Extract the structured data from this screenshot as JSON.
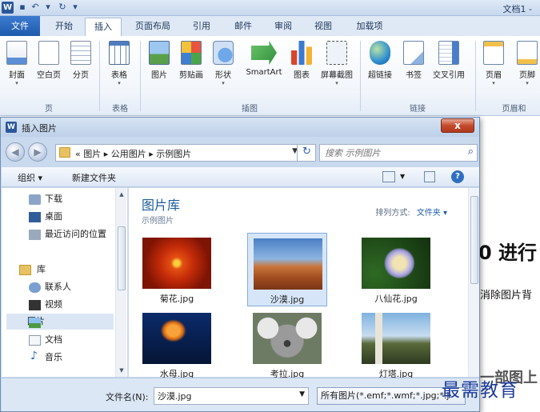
{
  "titlebar": {
    "app_icon": "W",
    "doc_title": "文档1 -"
  },
  "tabs": [
    {
      "label": "文件"
    },
    {
      "label": "开始"
    },
    {
      "label": "插入"
    },
    {
      "label": "页面布局"
    },
    {
      "label": "引用"
    },
    {
      "label": "邮件"
    },
    {
      "label": "审阅"
    },
    {
      "label": "视图"
    },
    {
      "label": "加载项"
    }
  ],
  "ribbon": {
    "buttons": [
      {
        "label": "封面",
        "icon": "cover-page-icon"
      },
      {
        "label": "空白页",
        "icon": "blank-page-icon"
      },
      {
        "label": "分页",
        "icon": "page-break-icon"
      },
      {
        "label": "表格",
        "icon": "table-icon"
      },
      {
        "label": "图片",
        "icon": "picture-icon"
      },
      {
        "label": "剪贴画",
        "icon": "clip-art-icon"
      },
      {
        "label": "形状",
        "icon": "shapes-icon"
      },
      {
        "label": "SmartArt",
        "icon": "smartart-icon"
      },
      {
        "label": "图表",
        "icon": "chart-icon"
      },
      {
        "label": "屏幕截图",
        "icon": "screenshot-icon"
      },
      {
        "label": "超链接",
        "icon": "hyperlink-icon"
      },
      {
        "label": "书签",
        "icon": "bookmark-icon"
      },
      {
        "label": "交叉引用",
        "icon": "cross-reference-icon"
      },
      {
        "label": "页眉",
        "icon": "header-icon"
      },
      {
        "label": "页脚",
        "icon": "footer-icon"
      }
    ],
    "groups": [
      "页",
      "表格",
      "插图",
      "链接",
      "页眉和"
    ]
  },
  "document": {
    "heading_fragment": "0 进行",
    "line_fragment": "消除图片背",
    "bottom_fragment": "一部图上"
  },
  "dialog": {
    "title": "插入图片",
    "close_label": "x",
    "address": {
      "prefix": "«",
      "crumbs": "图片  ▸  公用图片  ▸  示例图片"
    },
    "search": {
      "placeholder": "搜索 示例图片"
    },
    "toolbar": {
      "organize": "组织 ▾",
      "new_folder": "新建文件夹"
    },
    "nav": [
      {
        "label": "下载",
        "icon": "downloads-icon"
      },
      {
        "label": "桌面",
        "icon": "desktop-icon"
      },
      {
        "label": "最近访问的位置",
        "icon": "recent-places-icon"
      },
      {
        "label": "库",
        "icon": "library-icon"
      },
      {
        "label": "联系人",
        "icon": "contacts-icon"
      },
      {
        "label": "视频",
        "icon": "videos-icon"
      },
      {
        "label": "图片",
        "icon": "pictures-icon"
      },
      {
        "label": "文档",
        "icon": "documents-icon"
      },
      {
        "label": "音乐",
        "icon": "music-icon"
      }
    ],
    "library": {
      "title": "图片库",
      "subtitle": "示例图片",
      "arrange_label": "排列方式:",
      "arrange_value": "文件夹 ▾"
    },
    "files": [
      {
        "name": "菊花.jpg"
      },
      {
        "name": "沙漠.jpg"
      },
      {
        "name": "八仙花.jpg"
      },
      {
        "name": "水母.jpg"
      },
      {
        "name": "考拉.jpg"
      },
      {
        "name": "灯塔.jpg"
      }
    ],
    "filename_label": "文件名(N):",
    "filename_value": "沙漠.jpg",
    "filetype": "所有图片(*.emf;*.wmf;*.jpg;*.j"
  },
  "watermark": "最需教育"
}
